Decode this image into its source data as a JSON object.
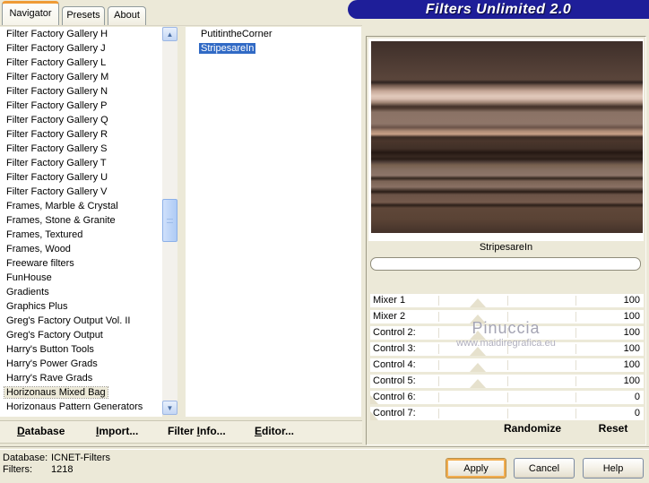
{
  "banner": {
    "title": "Filters Unlimited 2.0"
  },
  "tabs": {
    "navigator": "Navigator",
    "presets": "Presets",
    "about": "About"
  },
  "category_list": {
    "items": [
      "Filter Factory Gallery H",
      "Filter Factory Gallery J",
      "Filter Factory Gallery L",
      "Filter Factory Gallery M",
      "Filter Factory Gallery N",
      "Filter Factory Gallery P",
      "Filter Factory Gallery Q",
      "Filter Factory Gallery R",
      "Filter Factory Gallery S",
      "Filter Factory Gallery T",
      "Filter Factory Gallery U",
      "Filter Factory Gallery V",
      "Frames, Marble & Crystal",
      "Frames, Stone & Granite",
      "Frames, Textured",
      "Frames, Wood",
      "Freeware filters",
      "FunHouse",
      "Gradients",
      "Graphics Plus",
      "Greg's Factory Output Vol. II",
      "Greg's Factory Output",
      "Harry's Button Tools",
      "Harry's Power Grads",
      "Harry's Rave Grads",
      "Horizonaus Mixed Bag",
      "Horizonaus Pattern Generators"
    ],
    "selected_item": "Horizonaus Mixed Bag"
  },
  "filter_list": {
    "items": [
      "PutitintheCorner",
      "StripesareIn"
    ],
    "selected_item": "StripesareIn"
  },
  "preview": {
    "filter_name": "StripesareIn",
    "stripes": [
      {
        "p": 0,
        "c": "#3e2f2a"
      },
      {
        "p": 10,
        "c": "#4c3a32"
      },
      {
        "p": 20,
        "c": "#5a453b"
      },
      {
        "p": 21.5,
        "c": "#2e2320"
      },
      {
        "p": 23,
        "c": "#71594d"
      },
      {
        "p": 26,
        "c": "#c6a898"
      },
      {
        "p": 28.5,
        "c": "#e0c8ba"
      },
      {
        "p": 30,
        "c": "#d9bfb1"
      },
      {
        "p": 32,
        "c": "#a08575"
      },
      {
        "p": 34,
        "c": "#44332b"
      },
      {
        "p": 35,
        "c": "#4f3c32"
      },
      {
        "p": 37,
        "c": "#8a7265"
      },
      {
        "p": 43,
        "c": "#8f7669"
      },
      {
        "p": 45,
        "c": "#6b5449"
      },
      {
        "p": 47,
        "c": "#b28e78"
      },
      {
        "p": 48.5,
        "c": "#c79f86"
      },
      {
        "p": 50,
        "c": "#3b2b23"
      },
      {
        "p": 52,
        "c": "#4a362c"
      },
      {
        "p": 56,
        "c": "#413027"
      },
      {
        "p": 58,
        "c": "#241813"
      },
      {
        "p": 60,
        "c": "#362720"
      },
      {
        "p": 61.5,
        "c": "#2a1d17"
      },
      {
        "p": 63,
        "c": "#51403a"
      },
      {
        "p": 64.5,
        "c": "#77604f"
      },
      {
        "p": 67,
        "c": "#856e61"
      },
      {
        "p": 70,
        "c": "#8d766a"
      },
      {
        "p": 71.5,
        "c": "#33261f"
      },
      {
        "p": 73,
        "c": "#7b6355"
      },
      {
        "p": 76,
        "c": "#8a7164"
      },
      {
        "p": 78.5,
        "c": "#281c16"
      },
      {
        "p": 80,
        "c": "#6b5347"
      },
      {
        "p": 84,
        "c": "#745a4c"
      },
      {
        "p": 85.5,
        "c": "#2c1f18"
      },
      {
        "p": 87,
        "c": "#5f4739"
      },
      {
        "p": 93,
        "c": "#5a4335"
      },
      {
        "p": 100,
        "c": "#44322a"
      }
    ]
  },
  "slider_max": 255,
  "sliders": [
    {
      "label": "Mixer 1",
      "value": 100
    },
    {
      "label": "Mixer 2",
      "value": 100
    },
    {
      "label": "Control 2:",
      "value": 100
    },
    {
      "label": "Control 3:",
      "value": 100
    },
    {
      "label": "Control 4:",
      "value": 100
    },
    {
      "label": "Control 5:",
      "value": 100
    },
    {
      "label": "Control 6:",
      "value": 0
    },
    {
      "label": "Control 7:",
      "value": 0
    }
  ],
  "watermark": {
    "line1": "Pinuccia",
    "line2": "www.maidiregrafica.eu"
  },
  "panel_actions": {
    "randomize": "Randomize",
    "reset": "Reset"
  },
  "toolbar": {
    "database": {
      "pre": "",
      "key": "D",
      "post": "atabase"
    },
    "import": {
      "pre": "",
      "key": "I",
      "post": "mport..."
    },
    "filter_info": {
      "pre": "Filter ",
      "key": "I",
      "post": "nfo..."
    },
    "editor": {
      "pre": "",
      "key": "E",
      "post": "ditor..."
    }
  },
  "status": {
    "database_label": "Database:",
    "database_value": "ICNET-Filters",
    "filters_label": "Filters:",
    "filters_value": "1218"
  },
  "buttons": {
    "apply": "Apply",
    "cancel": "Cancel",
    "help": "Help"
  },
  "colors": {
    "selection": "#316ac5",
    "banner": "#1e1e99",
    "accent_orange": "#ef9b36"
  }
}
